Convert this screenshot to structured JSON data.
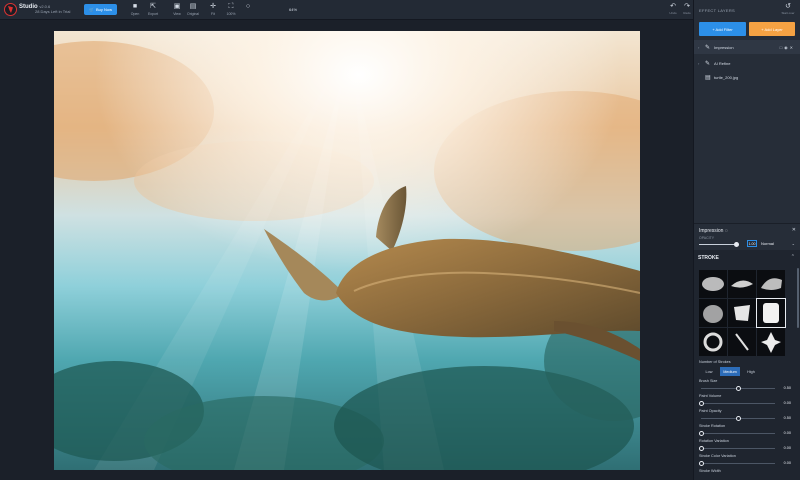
{
  "app": {
    "name": "Studio",
    "version": "v2.0.6",
    "trial": "28 Days Left in Trial",
    "buy_label": "Buy Now"
  },
  "toolbar": {
    "buttons": [
      {
        "label": "Open",
        "icon": "folder-icon"
      },
      {
        "label": "Export",
        "icon": "export-icon"
      },
      {
        "label": "View",
        "icon": "view-icon"
      },
      {
        "label": "Original",
        "icon": "original-image-icon"
      },
      {
        "label": "Fit",
        "icon": "fit-icon"
      },
      {
        "label": "100%",
        "icon": "actual-size-icon"
      }
    ],
    "zoom": "64%",
    "undo_label": "Undo",
    "redo_label": "Redo",
    "start_over_label": "Start over"
  },
  "panel": {
    "title": "EFFECT LAYERS",
    "add_filter": "+ Add Filter",
    "add_layer": "+ Add Layer",
    "layers": [
      {
        "label": "Impression",
        "icon": "brush-icon",
        "active": true
      },
      {
        "label": "AI Refine",
        "icon": "ai-icon",
        "active": false
      },
      {
        "label": "turtle_200.jpg",
        "icon": "image-icon",
        "active": false
      }
    ]
  },
  "filter": {
    "name": "Impression",
    "opacity_label": "OPACITY",
    "opacity_value": "1.00",
    "opacity_fraction": 1.0,
    "blend_mode": "Normal"
  },
  "stroke": {
    "heading": "STROKE",
    "brush_count": 9,
    "selected_brush": 5,
    "count_label": "Number of Strokes",
    "count_options": [
      "Low",
      "Medium",
      "High"
    ],
    "count_selected": "Medium",
    "params": [
      {
        "label": "Brush Size",
        "value": "0.50",
        "fraction": 0.5
      },
      {
        "label": "Paint Volume",
        "value": "0.00",
        "fraction": 0.0
      },
      {
        "label": "Paint Opacity",
        "value": "0.50",
        "fraction": 0.5
      },
      {
        "label": "Stroke Rotation",
        "value": "0.00",
        "fraction": 0.0
      },
      {
        "label": "Rotation Variation",
        "value": "0.00",
        "fraction": 0.0
      },
      {
        "label": "Stroke Color Variation",
        "value": "0.00",
        "fraction": 0.0
      },
      {
        "label": "Stroke Width",
        "value": "",
        "fraction": 0.0
      }
    ]
  },
  "colors": {
    "accent_blue": "#2c8fe8",
    "accent_orange": "#f5a243",
    "panel_bg": "#262d38"
  }
}
